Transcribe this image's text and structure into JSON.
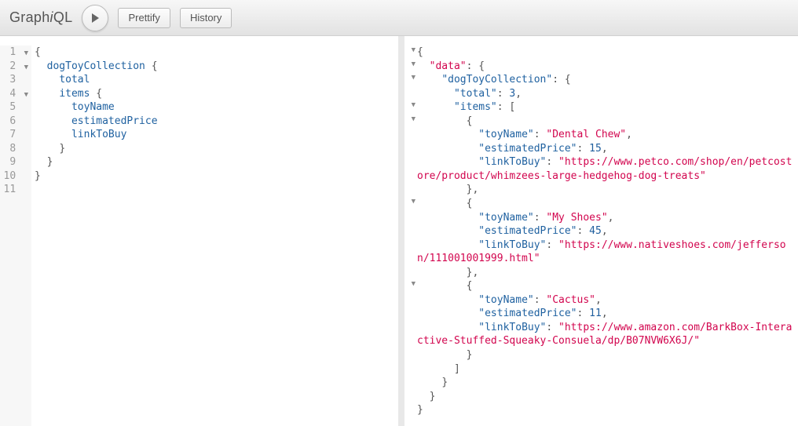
{
  "toolbar": {
    "logo_prefix": "Graph",
    "logo_em": "i",
    "logo_suffix": "QL",
    "prettify_label": "Prettify",
    "history_label": "History"
  },
  "query": {
    "lines": [
      {
        "n": 1,
        "fold": true,
        "tokens": [
          {
            "t": "{",
            "c": "brace"
          }
        ]
      },
      {
        "n": 2,
        "fold": true,
        "indent": 1,
        "tokens": [
          {
            "t": "dogToyCollection",
            "c": "prop"
          },
          {
            "t": " {",
            "c": "brace"
          }
        ]
      },
      {
        "n": 3,
        "fold": false,
        "indent": 2,
        "tokens": [
          {
            "t": "total",
            "c": "key"
          }
        ]
      },
      {
        "n": 4,
        "fold": true,
        "indent": 2,
        "tokens": [
          {
            "t": "items",
            "c": "prop"
          },
          {
            "t": " {",
            "c": "brace"
          }
        ]
      },
      {
        "n": 5,
        "fold": false,
        "indent": 3,
        "tokens": [
          {
            "t": "toyName",
            "c": "key"
          }
        ]
      },
      {
        "n": 6,
        "fold": false,
        "indent": 3,
        "tokens": [
          {
            "t": "estimatedPrice",
            "c": "key"
          }
        ]
      },
      {
        "n": 7,
        "fold": false,
        "indent": 3,
        "tokens": [
          {
            "t": "linkToBuy",
            "c": "key"
          }
        ]
      },
      {
        "n": 8,
        "fold": false,
        "indent": 2,
        "tokens": [
          {
            "t": "}",
            "c": "brace"
          }
        ]
      },
      {
        "n": 9,
        "fold": false,
        "indent": 1,
        "tokens": [
          {
            "t": "}",
            "c": "brace"
          }
        ]
      },
      {
        "n": 10,
        "fold": false,
        "tokens": [
          {
            "t": "}",
            "c": "brace"
          }
        ]
      },
      {
        "n": 11,
        "fold": false,
        "tokens": []
      }
    ]
  },
  "response": {
    "lines": [
      {
        "fold": true,
        "indent": 0,
        "tokens": [
          {
            "t": "{",
            "c": "brace"
          }
        ]
      },
      {
        "fold": true,
        "indent": 1,
        "tokens": [
          {
            "t": "\"data\"",
            "c": "str"
          },
          {
            "t": ": {",
            "c": "brace"
          }
        ]
      },
      {
        "fold": true,
        "indent": 2,
        "tokens": [
          {
            "t": "\"dogToyCollection\"",
            "c": "key"
          },
          {
            "t": ": {",
            "c": "brace"
          }
        ]
      },
      {
        "fold": false,
        "indent": 3,
        "tokens": [
          {
            "t": "\"total\"",
            "c": "key"
          },
          {
            "t": ": ",
            "c": "brace"
          },
          {
            "t": "3",
            "c": "num"
          },
          {
            "t": ",",
            "c": "brace"
          }
        ]
      },
      {
        "fold": true,
        "indent": 3,
        "tokens": [
          {
            "t": "\"items\"",
            "c": "key"
          },
          {
            "t": ": [",
            "c": "brace"
          }
        ]
      },
      {
        "fold": true,
        "indent": 4,
        "tokens": [
          {
            "t": "{",
            "c": "brace"
          }
        ]
      },
      {
        "fold": false,
        "indent": 5,
        "tokens": [
          {
            "t": "\"toyName\"",
            "c": "key"
          },
          {
            "t": ": ",
            "c": "brace"
          },
          {
            "t": "\"Dental Chew\"",
            "c": "str"
          },
          {
            "t": ",",
            "c": "brace"
          }
        ]
      },
      {
        "fold": false,
        "indent": 5,
        "tokens": [
          {
            "t": "\"estimatedPrice\"",
            "c": "key"
          },
          {
            "t": ": ",
            "c": "brace"
          },
          {
            "t": "15",
            "c": "num"
          },
          {
            "t": ",",
            "c": "brace"
          }
        ]
      },
      {
        "fold": false,
        "indent": 5,
        "tokens": [
          {
            "t": "\"linkToBuy\"",
            "c": "key"
          },
          {
            "t": ": ",
            "c": "brace"
          },
          {
            "t": "\"https://www.petco.com/shop/en/petcostore/product/whimzees-large-hedgehog-dog-treats\"",
            "c": "str"
          }
        ],
        "wrap": true
      },
      {
        "fold": false,
        "indent": 4,
        "tokens": [
          {
            "t": "},",
            "c": "brace"
          }
        ]
      },
      {
        "fold": true,
        "indent": 4,
        "tokens": [
          {
            "t": "{",
            "c": "brace"
          }
        ]
      },
      {
        "fold": false,
        "indent": 5,
        "tokens": [
          {
            "t": "\"toyName\"",
            "c": "key"
          },
          {
            "t": ": ",
            "c": "brace"
          },
          {
            "t": "\"My Shoes\"",
            "c": "str"
          },
          {
            "t": ",",
            "c": "brace"
          }
        ]
      },
      {
        "fold": false,
        "indent": 5,
        "tokens": [
          {
            "t": "\"estimatedPrice\"",
            "c": "key"
          },
          {
            "t": ": ",
            "c": "brace"
          },
          {
            "t": "45",
            "c": "num"
          },
          {
            "t": ",",
            "c": "brace"
          }
        ]
      },
      {
        "fold": false,
        "indent": 5,
        "tokens": [
          {
            "t": "\"linkToBuy\"",
            "c": "key"
          },
          {
            "t": ": ",
            "c": "brace"
          },
          {
            "t": "\"https://www.nativeshoes.com/jefferson/111001001999.html\"",
            "c": "str"
          }
        ],
        "wrap": true
      },
      {
        "fold": false,
        "indent": 4,
        "tokens": [
          {
            "t": "},",
            "c": "brace"
          }
        ]
      },
      {
        "fold": true,
        "indent": 4,
        "tokens": [
          {
            "t": "{",
            "c": "brace"
          }
        ]
      },
      {
        "fold": false,
        "indent": 5,
        "tokens": [
          {
            "t": "\"toyName\"",
            "c": "key"
          },
          {
            "t": ": ",
            "c": "brace"
          },
          {
            "t": "\"Cactus\"",
            "c": "str"
          },
          {
            "t": ",",
            "c": "brace"
          }
        ]
      },
      {
        "fold": false,
        "indent": 5,
        "tokens": [
          {
            "t": "\"estimatedPrice\"",
            "c": "key"
          },
          {
            "t": ": ",
            "c": "brace"
          },
          {
            "t": "11",
            "c": "num"
          },
          {
            "t": ",",
            "c": "brace"
          }
        ]
      },
      {
        "fold": false,
        "indent": 5,
        "tokens": [
          {
            "t": "\"linkToBuy\"",
            "c": "key"
          },
          {
            "t": ": ",
            "c": "brace"
          },
          {
            "t": "\"https://www.amazon.com/BarkBox-Interactive-Stuffed-Squeaky-Consuela/dp/B07NVW6X6J/\"",
            "c": "str"
          }
        ],
        "wrap": true
      },
      {
        "fold": false,
        "indent": 4,
        "tokens": [
          {
            "t": "}",
            "c": "brace"
          }
        ]
      },
      {
        "fold": false,
        "indent": 3,
        "tokens": [
          {
            "t": "]",
            "c": "brace"
          }
        ]
      },
      {
        "fold": false,
        "indent": 2,
        "tokens": [
          {
            "t": "}",
            "c": "brace"
          }
        ]
      },
      {
        "fold": false,
        "indent": 1,
        "tokens": [
          {
            "t": "}",
            "c": "brace"
          }
        ]
      },
      {
        "fold": false,
        "indent": 0,
        "tokens": [
          {
            "t": "}",
            "c": "brace"
          }
        ]
      }
    ]
  }
}
